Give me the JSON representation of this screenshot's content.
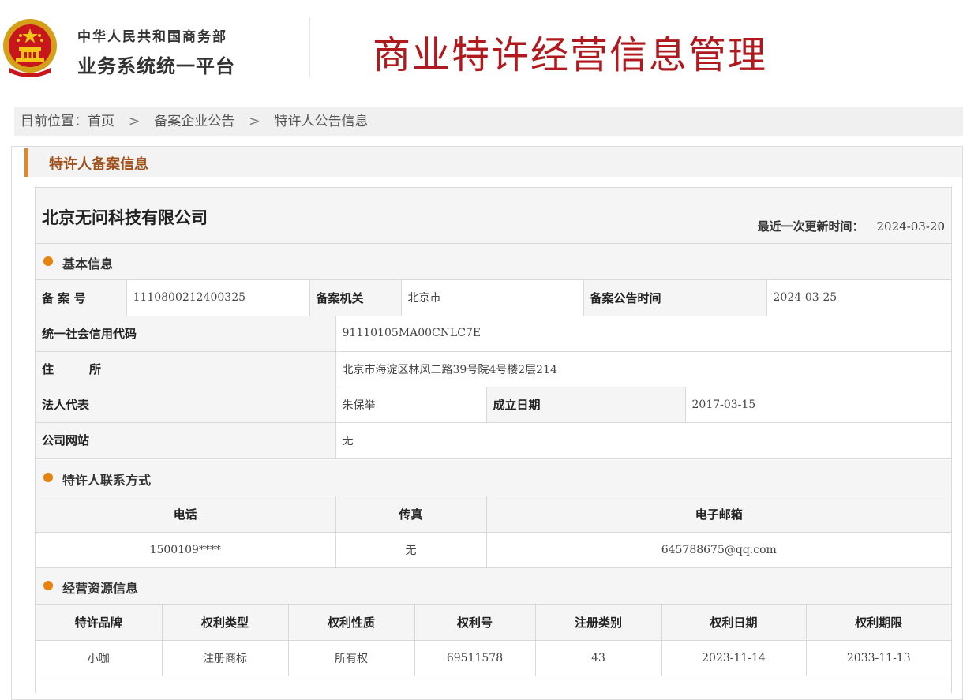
{
  "header": {
    "org_line1": "中华人民共和国商务部",
    "org_line2": "业务系统统一平台",
    "system_title": "商业特许经营信息管理"
  },
  "breadcrumb": {
    "label": "目前位置：",
    "items": [
      "首页",
      "备案企业公告",
      "特许人公告信息"
    ],
    "separator": ">"
  },
  "panel": {
    "title": "特许人备案信息"
  },
  "company": {
    "name": "北京无问科技有限公司",
    "update_label": "最近一次更新时间：",
    "update_value": "2024-03-20"
  },
  "basic": {
    "title": "基本信息",
    "record_no_label": "备 案 号",
    "record_no": "1110800212400325",
    "authority_label": "备案机关",
    "authority": "北京市",
    "announce_time_label": "备案公告时间",
    "announce_time": "2024-03-25",
    "credit_code_label": "统一社会信用代码",
    "credit_code": "91110105MA00CNLC7E",
    "address_label": "住　　　所",
    "address": "北京市海淀区林风二路39号院4号楼2层214",
    "legal_rep_label": "法人代表",
    "legal_rep": "朱保举",
    "founded_label": "成立日期",
    "founded": "2017-03-15",
    "website_label": "公司网站",
    "website": "无"
  },
  "contact": {
    "title": "特许人联系方式",
    "headers": [
      "电话",
      "传真",
      "电子邮箱"
    ],
    "phone": "1500109****",
    "fax": "无",
    "email": "645788675@qq.com"
  },
  "resources": {
    "title": "经营资源信息",
    "headers": [
      "特许品牌",
      "权利类型",
      "权利性质",
      "权利号",
      "注册类别",
      "权利日期",
      "权利期限"
    ],
    "rows": [
      [
        "小咖",
        "注册商标",
        "所有权",
        "69511578",
        "43",
        "2023-11-14",
        "2033-11-13"
      ]
    ]
  },
  "colors": {
    "title_red": "#b0191d",
    "accent_orange": "#e8820f",
    "panel_bar": "#d98a2d",
    "panel_title": "#a0521a"
  }
}
